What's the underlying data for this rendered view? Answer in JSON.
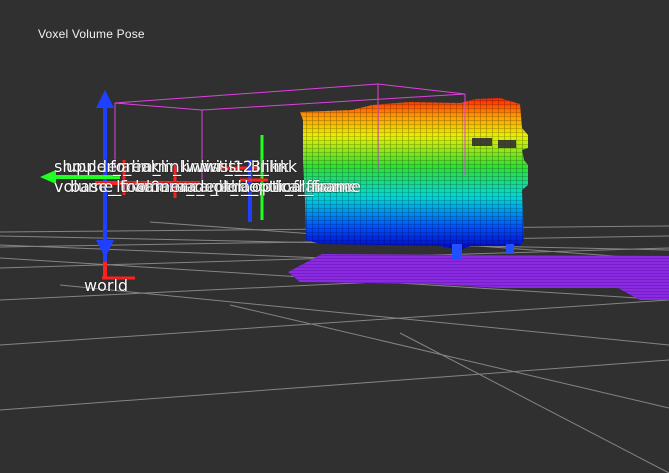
{
  "overlay": {
    "title": "Voxel Volume Pose"
  },
  "frame_labels": [
    "shoulder_link",
    "upper_arm_link",
    "forearm_link",
    "wrist_1_link",
    "wrist_2_link",
    "wrist_3_link",
    "volume_frame",
    "base_link",
    "tool0",
    "camera_link",
    "camera_depth_frame",
    "camera_color_frame",
    "camera_depth_optical_frame",
    "camera_color_optical_frame",
    "world"
  ],
  "colors": {
    "background": "#303030",
    "grid": "#a0a0a0",
    "bounding_box": "#e040e0",
    "axis_x": "#ff2020",
    "axis_y": "#20ff20",
    "axis_z": "#2040ff",
    "voxel_floor": "#8a2be2",
    "voxel_gradient": [
      "#ff0000",
      "#ffa500",
      "#ffff00",
      "#00ff00",
      "#00ffff",
      "#0000ff"
    ]
  }
}
